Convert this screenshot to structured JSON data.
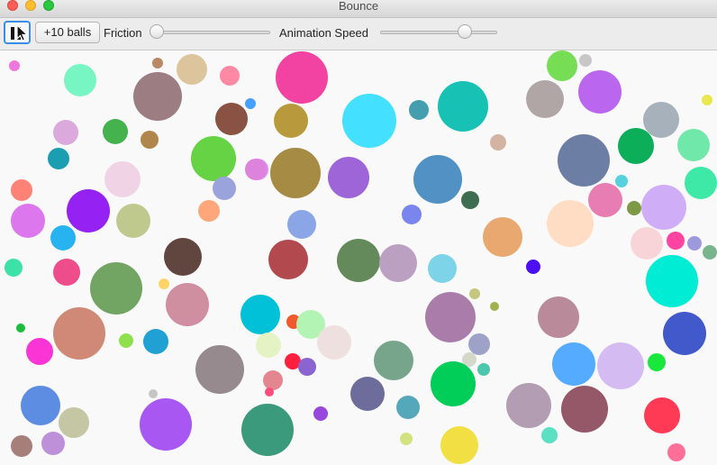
{
  "window": {
    "title": "Bounce"
  },
  "toolbar": {
    "add_balls_label": "+10 balls",
    "friction_label": "Friction",
    "friction_value": 0.0,
    "speed_label": "Animation Speed",
    "speed_value": 0.75,
    "state": "paused"
  },
  "balls": [
    {
      "color": "#ee77dd"
    },
    {
      "color": "#77f5c3"
    },
    {
      "color": "#bb8866"
    },
    {
      "color": "#9c7d82"
    },
    {
      "color": "#dcc49c"
    },
    {
      "color": "#ff88a4"
    },
    {
      "color": "#f243a3"
    },
    {
      "color": "#77dd55"
    },
    {
      "color": "#c7c7c7"
    },
    {
      "color": "#bb66ee"
    },
    {
      "color": "#e8e84e"
    },
    {
      "color": "#dba9dc"
    },
    {
      "color": "#44b34d"
    },
    {
      "color": "#b0864c"
    },
    {
      "color": "#8a5243"
    },
    {
      "color": "#46a0ff"
    },
    {
      "color": "#b89a3c"
    },
    {
      "color": "#e28af2"
    },
    {
      "color": "#44e0ff"
    },
    {
      "color": "#459db0"
    },
    {
      "color": "#17c2b5"
    },
    {
      "color": "#d3b3a2"
    },
    {
      "color": "#b0a6a6"
    },
    {
      "color": "#a6b1bb"
    },
    {
      "color": "#0cae5a"
    },
    {
      "color": "#6d7ea5"
    },
    {
      "color": "#6fe8a9"
    },
    {
      "color": "#1c9eb2"
    },
    {
      "color": "#f0d4e6"
    },
    {
      "color": "#66d344"
    },
    {
      "color": "#de83dd"
    },
    {
      "color": "#a68b44"
    },
    {
      "color": "#9e65d8"
    },
    {
      "color": "#5291c4"
    },
    {
      "color": "#ff8277"
    },
    {
      "color": "#dd77ee"
    },
    {
      "color": "#9522f2"
    },
    {
      "color": "#bfc98e"
    },
    {
      "color": "#9ba3dc"
    },
    {
      "color": "#ffa77a"
    },
    {
      "color": "#8aa6e6"
    },
    {
      "color": "#7a85ee"
    },
    {
      "color": "#3e6e52"
    },
    {
      "color": "#e8a86f"
    },
    {
      "color": "#ffdcc4"
    },
    {
      "color": "#e87db3"
    },
    {
      "color": "#56d1dd"
    },
    {
      "color": "#7d9946"
    },
    {
      "color": "#d0aef7"
    },
    {
      "color": "#3ee8a6"
    },
    {
      "color": "#27b3f0"
    },
    {
      "color": "#3de2a8"
    },
    {
      "color": "#614640"
    },
    {
      "color": "#b2494f"
    },
    {
      "color": "#648a5b"
    },
    {
      "color": "#bca0c2"
    },
    {
      "color": "#7dd3e8"
    },
    {
      "color": "#4d10f5"
    },
    {
      "color": "#f8d4d9"
    },
    {
      "color": "#ff44a2"
    },
    {
      "color": "#9e99dd"
    },
    {
      "color": "#7ab48f"
    },
    {
      "color": "#ee4d8c"
    },
    {
      "color": "#72a463"
    },
    {
      "color": "#ffd466"
    },
    {
      "color": "#d08ea1"
    },
    {
      "color": "#00c1d7"
    },
    {
      "color": "#00ecd5"
    },
    {
      "color": "#c4c77c"
    },
    {
      "color": "#a97ca9"
    },
    {
      "color": "#9fb24e"
    },
    {
      "color": "#b98a9a"
    },
    {
      "color": "#4259cb"
    },
    {
      "color": "#1dbd3b"
    },
    {
      "color": "#d08976"
    },
    {
      "color": "#f05a2c"
    },
    {
      "color": "#b3f3b4"
    },
    {
      "color": "#efe0e0"
    },
    {
      "color": "#fb34d5"
    },
    {
      "color": "#90e04d"
    },
    {
      "color": "#21a0d4"
    },
    {
      "color": "#e5f2c4"
    },
    {
      "color": "#9ea2c9"
    },
    {
      "color": "#d2d9c9"
    },
    {
      "color": "#4cc7ae"
    },
    {
      "color": "#ff1f3e"
    },
    {
      "color": "#8a65d2"
    },
    {
      "color": "#968a8e"
    },
    {
      "color": "#77a58b"
    },
    {
      "color": "#54abff"
    },
    {
      "color": "#d4bbf2"
    },
    {
      "color": "#18e83c"
    },
    {
      "color": "#e4868f"
    },
    {
      "color": "#ff3a55"
    },
    {
      "color": "#5d8de3"
    },
    {
      "color": "#c5c6a4"
    },
    {
      "color": "#c5c5c5"
    },
    {
      "color": "#a957f3"
    },
    {
      "color": "#3a9a7b"
    },
    {
      "color": "#6e6c9b"
    },
    {
      "color": "#55a7ba"
    },
    {
      "color": "#00ce58"
    },
    {
      "color": "#b39db2"
    },
    {
      "color": "#955869"
    },
    {
      "color": "#ff4b7a"
    },
    {
      "color": "#9749dd"
    },
    {
      "color": "#a67f7b"
    },
    {
      "color": "#bd90d8"
    },
    {
      "color": "#22f4ff"
    },
    {
      "color": "#d3e281"
    },
    {
      "color": "#f2df44"
    },
    {
      "color": "#5ce0c4"
    },
    {
      "color": "#ff6f97"
    }
  ]
}
